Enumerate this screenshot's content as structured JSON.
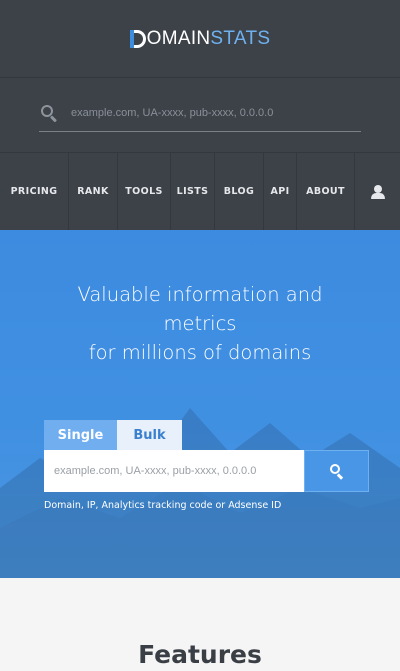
{
  "brand": {
    "name_main": "OMAIN",
    "name_stats": "STATS",
    "accent": "#3c8dde",
    "stats_color": "#6fb1ef"
  },
  "header_search": {
    "placeholder": "example.com, UA-xxxx, pub-xxxx, 0.0.0.0",
    "icon": "search-icon"
  },
  "nav": {
    "items": [
      {
        "label": "PRICING"
      },
      {
        "label": "RANK"
      },
      {
        "label": "TOOLS"
      },
      {
        "label": "LISTS"
      },
      {
        "label": "BLOG"
      },
      {
        "label": "API"
      },
      {
        "label": "ABOUT"
      }
    ],
    "user_icon": "user-icon"
  },
  "hero": {
    "title_line1": "Valuable information and",
    "title_line2": "metrics",
    "title_line3": "for millions of domains",
    "tabs": [
      {
        "label": "Single",
        "active": true
      },
      {
        "label": "Bulk",
        "active": false
      }
    ],
    "input_placeholder": "example.com, UA-xxxx, pub-xxxx, 0.0.0.0",
    "hint": "Domain, IP, Analytics tracking code or Adsense ID",
    "background": "#3d8be0"
  },
  "features": {
    "heading": "Features"
  }
}
